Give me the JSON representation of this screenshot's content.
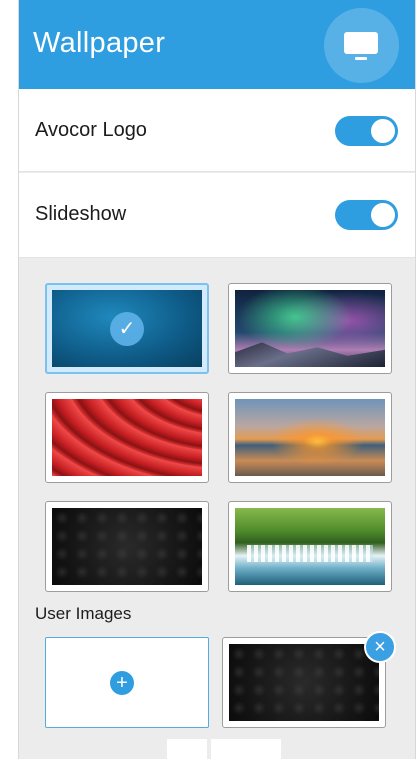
{
  "header": {
    "title": "Wallpaper",
    "icon": "display-icon"
  },
  "settings": [
    {
      "label": "Avocor Logo",
      "enabled": true
    },
    {
      "label": "Slideshow",
      "enabled": true
    }
  ],
  "wallpapers": [
    {
      "name": "blue-texture",
      "selected": true
    },
    {
      "name": "aurora-mountains",
      "selected": false
    },
    {
      "name": "red-waves",
      "selected": false
    },
    {
      "name": "sunset-beach",
      "selected": false
    },
    {
      "name": "dark-hexagon",
      "selected": false
    },
    {
      "name": "waterfall",
      "selected": false
    }
  ],
  "user_images": {
    "label": "User Images",
    "add_icon": "+",
    "remove_icon": "×",
    "check_icon": "✓"
  },
  "colors": {
    "accent": "#2f9ee0",
    "panel_bg": "#ececec"
  }
}
